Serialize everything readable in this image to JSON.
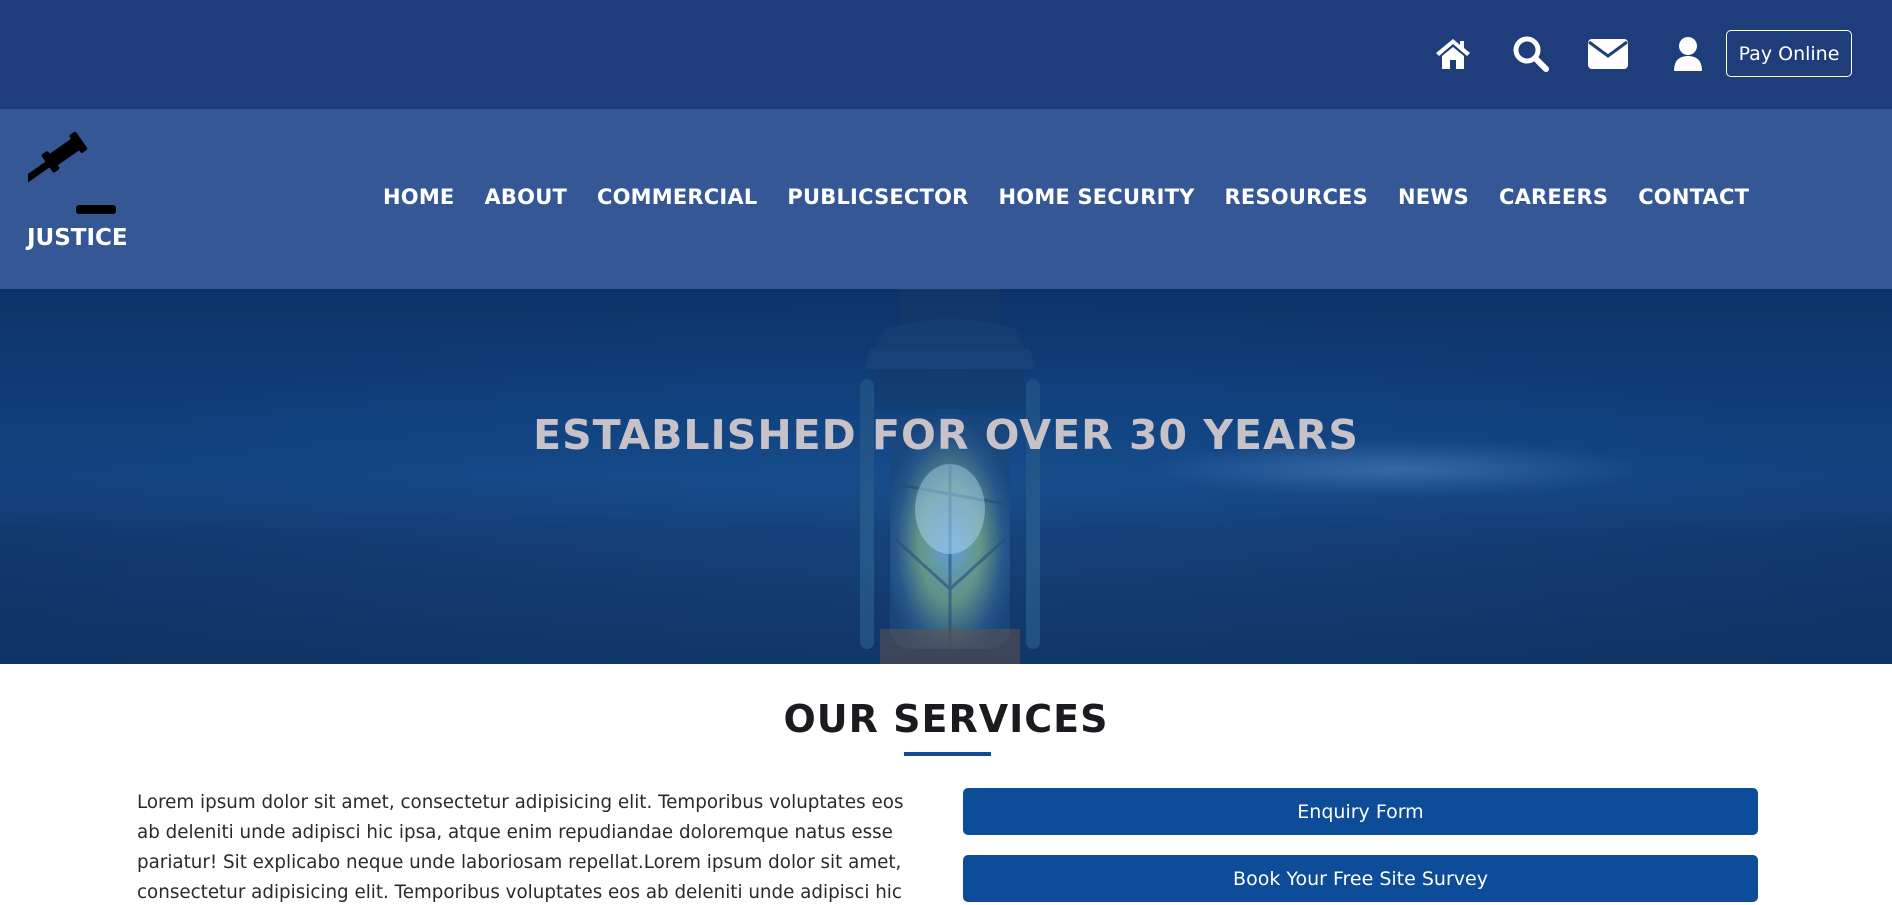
{
  "topbar": {
    "icons": [
      "home-icon",
      "search-icon",
      "envelope-icon",
      "user-icon"
    ],
    "pay_label": "Pay Online"
  },
  "brand": {
    "name": "JUSTICE"
  },
  "nav": {
    "items": [
      "HOME",
      "ABOUT",
      "COMMERCIAL",
      "PUBLICSECTOR",
      "HOME SECURITY",
      "RESOURCES",
      "NEWS",
      "CAREERS",
      "CONTACT"
    ]
  },
  "hero": {
    "title": "ESTABLISHED FOR OVER 30 YEARS"
  },
  "services": {
    "title": "OUR SERVICES",
    "paragraph": "Lorem ipsum dolor sit amet, consectetur adipisicing elit. Temporibus voluptates eos ab deleniti unde adipisci hic ipsa, atque enim repudiandae doloremque natus esse pariatur! Sit explicabo neque unde laboriosam repellat.Lorem ipsum dolor sit amet, consectetur adipisicing elit. Temporibus voluptates eos ab deleniti unde adipisci hic ipsa, atque enim",
    "buttons": [
      "Enquiry Form",
      "Book Your Free Site Survey"
    ]
  },
  "colors": {
    "topbar": "#1f3d7a",
    "navbar": "#355796",
    "accent": "#0d4c99",
    "hero_title": "#c7c2c8"
  }
}
